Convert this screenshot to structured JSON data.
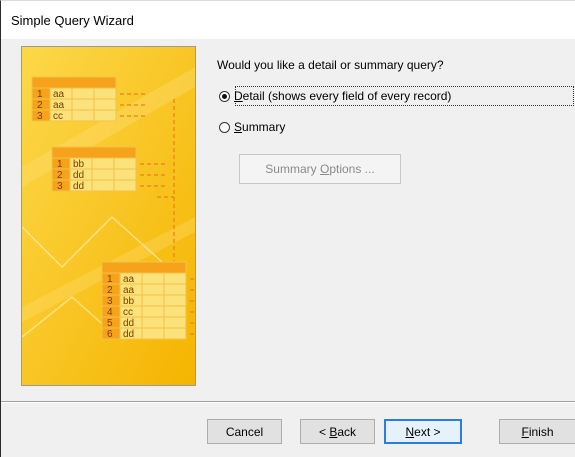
{
  "window": {
    "title": "Simple Query Wizard"
  },
  "illustration": {
    "table1": [
      [
        "1",
        "aa"
      ],
      [
        "2",
        "aa"
      ],
      [
        "3",
        "cc"
      ]
    ],
    "table2": [
      [
        "1",
        "bb"
      ],
      [
        "2",
        "dd"
      ],
      [
        "3",
        "dd"
      ]
    ],
    "table3": [
      [
        "1",
        "aa"
      ],
      [
        "2",
        "aa"
      ],
      [
        "3",
        "bb"
      ],
      [
        "4",
        "cc"
      ],
      [
        "5",
        "dd"
      ],
      [
        "6",
        "dd"
      ]
    ]
  },
  "main": {
    "question": "Would you like a detail or summary query?",
    "options": [
      {
        "mnemonic": "D",
        "rest": "etail (shows every field of every record)",
        "checked": true
      },
      {
        "mnemonic": "S",
        "rest": "ummary",
        "checked": false
      }
    ],
    "summary_options": {
      "before": "Summary ",
      "mnemonic": "O",
      "after": "ptions ..."
    }
  },
  "buttons": {
    "cancel": "Cancel",
    "back": {
      "before": "< ",
      "mnemonic": "B",
      "after": "ack"
    },
    "next": {
      "before": "",
      "mnemonic": "N",
      "after": "ext >"
    },
    "finish": {
      "before": "",
      "mnemonic": "F",
      "after": "inish"
    }
  },
  "colors": {
    "illustration_bg_top": "#fbd33f",
    "illustration_bg_bottom": "#f5b800",
    "cell_fill": "#fbe87a",
    "dash_orange": "#f07d1a",
    "default_button_border": "#2c7de0"
  }
}
